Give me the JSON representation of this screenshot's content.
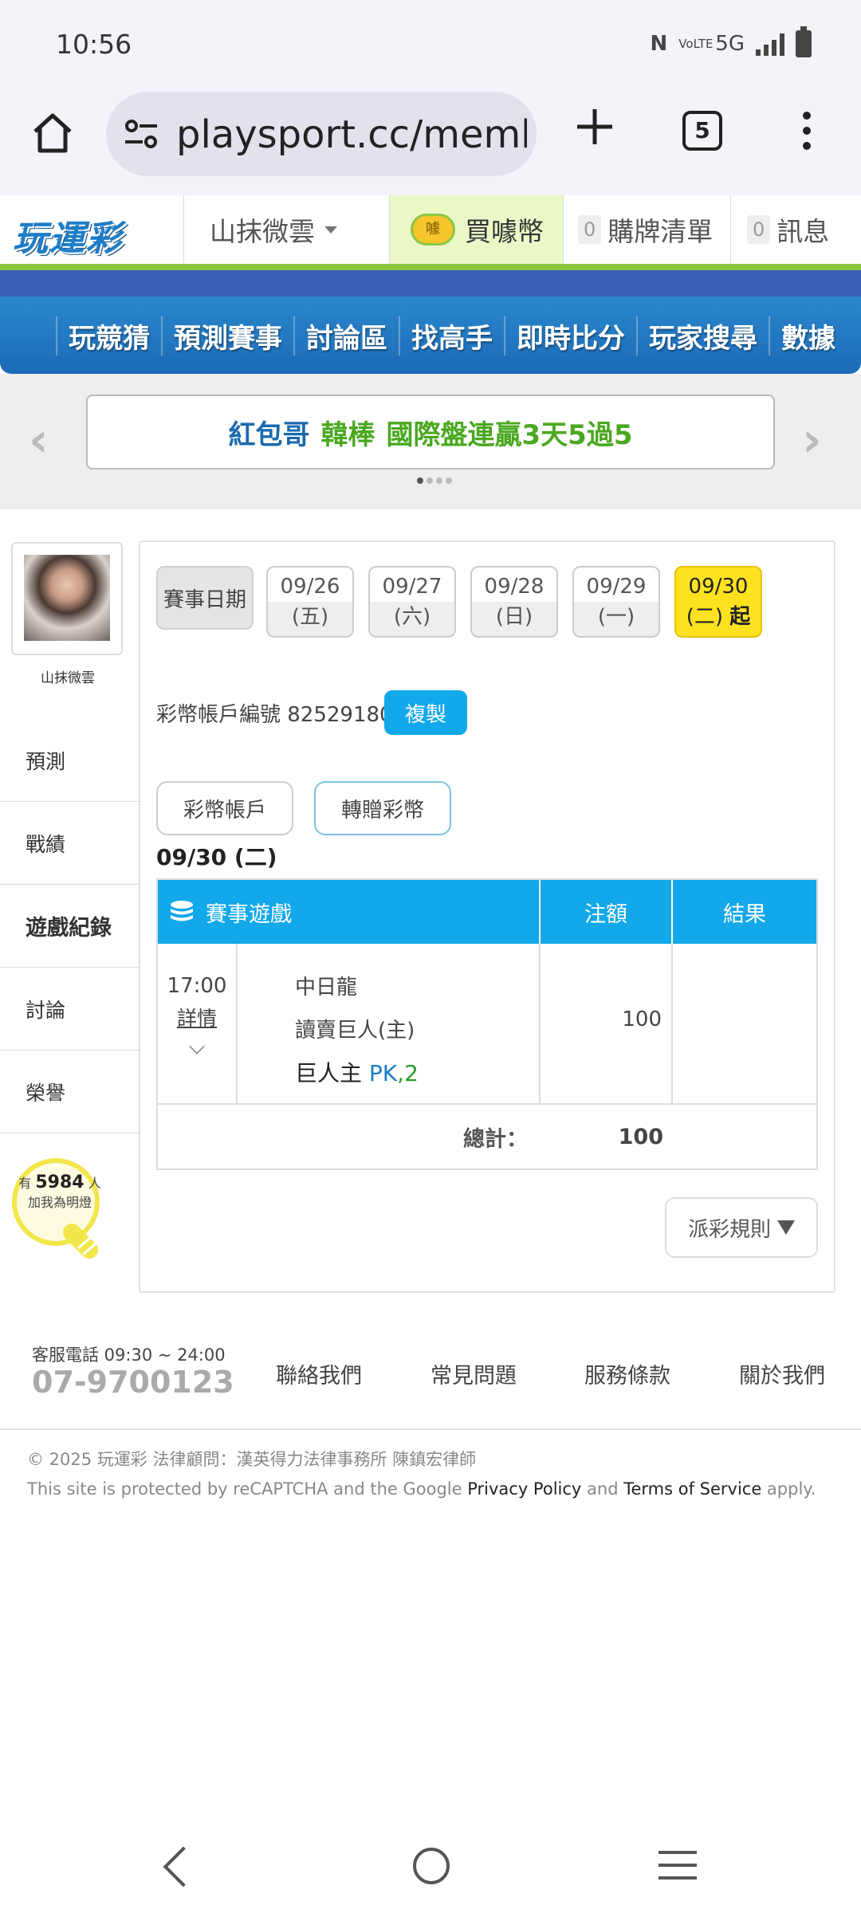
{
  "status_bar": {
    "time": "10:56",
    "icons": [
      "nfc-icon",
      "volte-icon",
      "5g-icon",
      "signal-icon",
      "battery-icon"
    ],
    "network": "5G",
    "volte": "VoLTE"
  },
  "browser": {
    "url": "playsport.cc/memb",
    "tab_count": "5"
  },
  "site": {
    "logo_text": "玩運彩",
    "username": "山抹微雲",
    "buy_coins": "買噱幣",
    "coin_icon_text": "噱",
    "cart_count": "0",
    "cart_label": "購牌清單",
    "msg_count": "0",
    "msg_label": "訊息"
  },
  "nav": {
    "items": [
      "玩競猜",
      "預測賽事",
      "討論區",
      "找高手",
      "即時比分",
      "玩家搜尋",
      "數據"
    ]
  },
  "banner": {
    "part1": "紅包哥",
    "part2": "韓棒",
    "part3": "國際盤連贏3天5過5",
    "slide_index": 1,
    "slide_count": 4
  },
  "sidebar": {
    "username": "山抹微雲",
    "items": [
      "預測",
      "戰績",
      "遊戲紀錄",
      "討論",
      "榮譽"
    ],
    "active_index": 2,
    "fans_prefix": "有",
    "fans_count": "5984",
    "fans_suffix": "人",
    "fans_line2": "加我為明燈"
  },
  "dates": {
    "label": "賽事日期",
    "chips": [
      {
        "date": "09/26",
        "day": "(五)"
      },
      {
        "date": "09/27",
        "day": "(六)"
      },
      {
        "date": "09/28",
        "day": "(日)"
      },
      {
        "date": "09/29",
        "day": "(一)"
      },
      {
        "date": "09/30",
        "day": "(二)",
        "suffix": "起"
      }
    ],
    "active_index": 4
  },
  "account": {
    "label": "彩幣帳戶編號 82529180",
    "copy_button": "複製",
    "tab_account": "彩幣帳戶",
    "tab_transfer": "轉贈彩幣"
  },
  "records": {
    "day_title": "09/30 (二)",
    "headers": {
      "game": "賽事遊戲",
      "amount": "注額",
      "result": "結果"
    },
    "rows": [
      {
        "time": "17:00",
        "detail_link": "詳情",
        "away": "中日龍",
        "home": "讀賣巨人(主)",
        "pick": "巨人主",
        "bet_type": "PK",
        "odds": ",2",
        "amount": "100",
        "result": ""
      }
    ],
    "total_label": "總計：",
    "total_value": "100",
    "rules_button": "派彩規則"
  },
  "footer": {
    "service_hours": "客服電話 09:30 ~ 24:00",
    "phone": "07-9700123",
    "links": [
      "聯絡我們",
      "常見問題",
      "服務條款",
      "關於我們"
    ],
    "copyright": "© 2025 玩運彩 法律顧問：漢英得力法律事務所 陳鎮宏律師",
    "recaptcha_pre": "This site is protected by reCAPTCHA and the Google ",
    "privacy": "Privacy Policy",
    "and": " and ",
    "terms": "Terms of Service",
    "recaptcha_post": " apply."
  },
  "colors": {
    "accent_blue": "#12a8ea",
    "nav_green": "#8cc63f",
    "active_date": "#ffe21f",
    "banner_blue": "#1a6ab0",
    "banner_green": "#4aa820"
  }
}
